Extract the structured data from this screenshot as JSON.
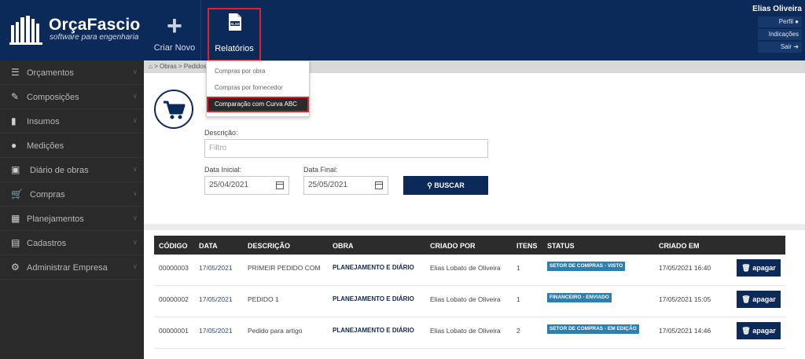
{
  "brand": {
    "name": "OrçaFascio",
    "subtitle": "software para engenharia"
  },
  "topbar": {
    "new_label": "Criar Novo",
    "reports_label": "Relatórios",
    "reports_icon_text": "XLSX"
  },
  "user": {
    "name": "Elias Oliveira",
    "links": [
      "Perfil",
      "Indicações",
      "Sair"
    ]
  },
  "sidebar": {
    "items": [
      {
        "label": "Orçamentos",
        "icon": "list-icon"
      },
      {
        "label": "Composições",
        "icon": "pencil-icon"
      },
      {
        "label": "Insumos",
        "icon": "eraser-icon"
      },
      {
        "label": "Medições",
        "icon": "drop-icon"
      },
      {
        "label": "Diário de obras",
        "icon": "book-icon"
      },
      {
        "label": "Compras",
        "icon": "cart-icon"
      },
      {
        "label": "Planejamentos",
        "icon": "calendar-icon"
      },
      {
        "label": "Cadastros",
        "icon": "clipboard-icon"
      },
      {
        "label": "Administrar Empresa",
        "icon": "gear-icon"
      }
    ]
  },
  "breadcrumb": {
    "items": [
      "Obras",
      "Pedidos"
    ]
  },
  "dropdown": {
    "items": [
      "Compras por obra",
      "Compras por fornecedor",
      "Comparação com Curva ABC"
    ]
  },
  "filters": {
    "description_label": "Descrição:",
    "description_placeholder": "Filtro",
    "start_label": "Data Inicial:",
    "start_value": "25/04/2021",
    "end_label": "Data Final:",
    "end_value": "25/05/2021",
    "search_button": "BUSCAR"
  },
  "table": {
    "headers": [
      "CÓDIGO",
      "DATA",
      "DESCRIÇÃO",
      "OBRA",
      "CRIADO POR",
      "ITENS",
      "STATUS",
      "CRIADO EM"
    ],
    "rows": [
      {
        "codigo": "00000003",
        "data": "17/05/2021",
        "descricao": "PRIMEIR PEDIDO COM",
        "obra": "PLANEJAMENTO E DIÁRIO",
        "criado_por": "Elias Lobato de Oliveira",
        "itens": "1",
        "status": "SETOR DE COMPRAS - VISTO",
        "criado_em": "17/05/2021 16:40"
      },
      {
        "codigo": "00000002",
        "data": "17/05/2021",
        "descricao": "PEDIDO 1",
        "obra": "PLANEJAMENTO E DIÁRIO",
        "criado_por": "Elias Lobato de Oliveira",
        "itens": "1",
        "status": "FINANCEIRO - ENVIADO",
        "criado_em": "17/05/2021 15:05"
      },
      {
        "codigo": "00000001",
        "data": "17/05/2021",
        "descricao": "Pedido para artigo",
        "obra": "PLANEJAMENTO E DIÁRIO",
        "criado_por": "Elias Lobato de Oliveira",
        "itens": "2",
        "status": "SETOR DE COMPRAS - EM EDIÇÃO",
        "criado_em": "17/05/2021 14:46"
      }
    ],
    "delete_label": "apagar"
  },
  "colors": {
    "navy": "#0b2a59",
    "sidebar": "#2a2a2a",
    "highlight": "#d9232d",
    "badge": "#2e7fae"
  }
}
